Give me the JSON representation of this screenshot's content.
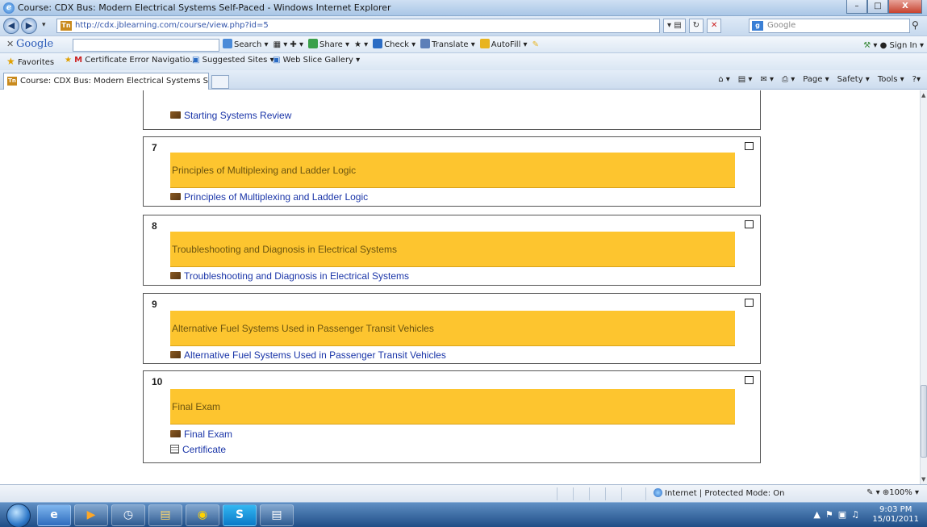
{
  "window": {
    "title": "Course: CDX Bus: Modern Electrical Systems Self-Paced - Windows Internet Explorer",
    "min": "–",
    "max": "□",
    "close": "X"
  },
  "address": {
    "url": "http://cdx.jblearning.com/course/view.php?id=5",
    "search_placeholder": "Google"
  },
  "google_toolbar": {
    "logo": "Google",
    "items": [
      "Search ▾",
      "Share ▾",
      "Check ▾",
      "Translate ▾",
      "AutoFill ▾"
    ],
    "signin": "Sign In ▾"
  },
  "favorites": {
    "label": "Favorites",
    "items": [
      "Certificate Error Navigatio...",
      "Suggested Sites ▾",
      "Web Slice Gallery ▾"
    ]
  },
  "tab": {
    "label": "Course: CDX Bus: Modern Electrical Systems Self-..."
  },
  "commandbar": {
    "items": [
      "Page ▾",
      "Safety ▾",
      "Tools ▾",
      "?▾"
    ]
  },
  "prev_section": {
    "resource": "Starting Systems Review"
  },
  "sections": [
    {
      "num": "7",
      "title": "Principles of Multiplexing and Ladder Logic",
      "resources": [
        "Principles of Multiplexing and Ladder Logic"
      ]
    },
    {
      "num": "8",
      "title": "Troubleshooting and Diagnosis in Electrical Systems",
      "resources": [
        "Troubleshooting and Diagnosis in Electrical Systems"
      ]
    },
    {
      "num": "9",
      "title": "Alternative Fuel Systems Used in Passenger Transit Vehicles",
      "resources": [
        "Alternative Fuel Systems Used in Passenger Transit Vehicles"
      ]
    },
    {
      "num": "10",
      "title": "Final Exam",
      "resources": [
        "Final Exam",
        "Certificate"
      ]
    }
  ],
  "status": {
    "zone": "Internet | Protected Mode: On",
    "zoom": "100%"
  },
  "taskbar": {
    "time": "9:03 PM",
    "date": "15/01/2011"
  },
  "colors": {
    "section_header": "#fdc52f",
    "link": "#1a35a8"
  }
}
